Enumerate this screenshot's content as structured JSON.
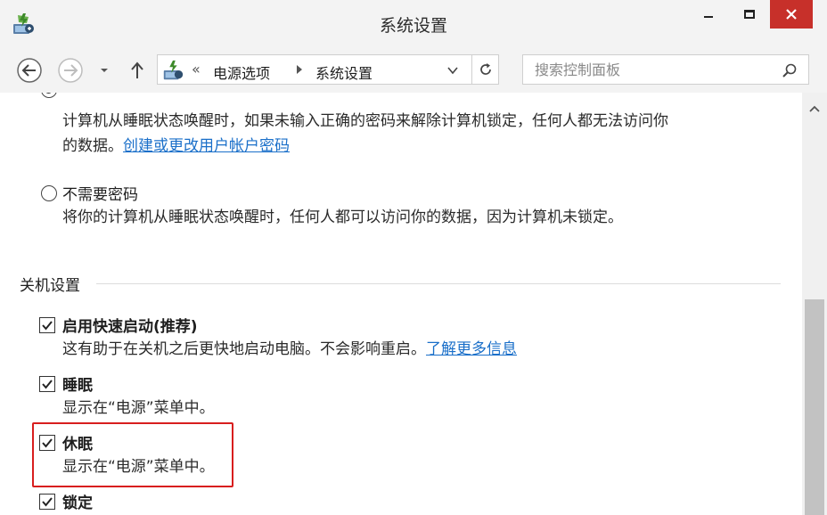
{
  "window": {
    "title": "系统设置",
    "app_icon": "power-options-icon"
  },
  "nav": {
    "breadcrumb_prefix": "«",
    "crumbs": [
      "电源选项",
      "系统设置"
    ],
    "search_placeholder": "搜索控制面板"
  },
  "password": {
    "require_desc_line1": "计算机从睡眠状态唤醒时，如果未输入正确的密码来解除计算机锁定，任何人都无法访问你",
    "require_desc_line2_prefix": "的数据。",
    "require_link": "创建或更改用户帐户密码",
    "no_password_label": "不需要密码",
    "no_password_desc": "将你的计算机从睡眠状态唤醒时，任何人都可以访问你的数据，因为计算机未锁定。"
  },
  "shutdown": {
    "section_title": "关机设置",
    "items": [
      {
        "label": "启用快速启动(推荐)",
        "desc": "这有助于在关机之后更快地启动电脑。不会影响重启。",
        "link": "了解更多信息",
        "checked": true
      },
      {
        "label": "睡眠",
        "desc": "显示在“电源”菜单中。",
        "checked": true
      },
      {
        "label": "休眠",
        "desc": "显示在“电源”菜单中。",
        "checked": true
      },
      {
        "label": "锁定",
        "checked": true
      }
    ]
  },
  "colors": {
    "accent_link": "#1a6fc9",
    "close_button": "#c7302a",
    "highlight_box": "#d81e1e"
  }
}
